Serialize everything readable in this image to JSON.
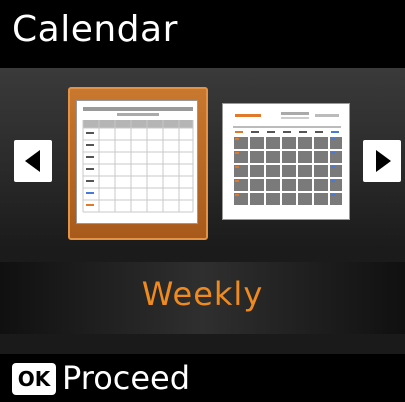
{
  "header": {
    "title": "Calendar"
  },
  "selector": {
    "left_arrow_icon": "left-triangle-icon",
    "right_arrow_icon": "right-triangle-icon",
    "options": [
      {
        "id": "weekly",
        "icon": "weekly-calendar-icon",
        "selected": true
      },
      {
        "id": "monthly",
        "icon": "monthly-calendar-icon",
        "selected": false
      }
    ],
    "selected_label": "Weekly",
    "accent_color": "#f08a1e"
  },
  "footer": {
    "ok_label": "OK",
    "proceed_label": "Proceed"
  }
}
